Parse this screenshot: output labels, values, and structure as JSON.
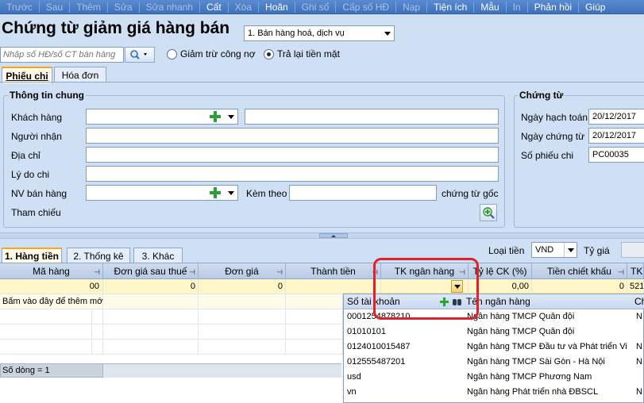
{
  "toolbar": {
    "items": [
      {
        "label": "Trước",
        "enabled": false
      },
      {
        "label": "Sau",
        "enabled": false
      },
      {
        "label": "Thêm",
        "enabled": false
      },
      {
        "label": "Sửa",
        "enabled": false
      },
      {
        "label": "Sửa nhanh",
        "enabled": false
      },
      {
        "label": "Cất",
        "enabled": true
      },
      {
        "label": "Xóa",
        "enabled": false
      },
      {
        "label": "Hoãn",
        "enabled": true
      },
      {
        "label": "Ghi sổ",
        "enabled": false
      },
      {
        "label": "Cấp số HĐ",
        "enabled": false
      },
      {
        "label": "Nạp",
        "enabled": false
      },
      {
        "label": "Tiện ích",
        "enabled": true
      },
      {
        "label": "Mẫu",
        "enabled": true
      },
      {
        "label": "In",
        "enabled": false
      },
      {
        "label": "Phản hồi",
        "enabled": true
      },
      {
        "label": "Giúp",
        "enabled": true
      }
    ]
  },
  "header": {
    "title": "Chứng từ giảm giá hàng bán",
    "type_selected": "1. Bán hàng hoá, dịch vụ",
    "search_placeholder": "Nhập số HĐ/số CT bán hàng",
    "radio_reduce": "Giảm trừ công nợ",
    "radio_cash": "Trả lại tiền mặt"
  },
  "doc_tabs": [
    "Phiếu chi",
    "Hóa đơn"
  ],
  "general": {
    "title": "Thông tin chung",
    "customer_label": "Khách hàng",
    "recipient_label": "Người nhận",
    "address_label": "Địa chỉ",
    "reason_label": "Lý do chi",
    "salesperson_label": "NV bán hàng",
    "attach_label": "Kèm theo",
    "attach_suffix": "chứng từ gốc",
    "reference_label": "Tham chiếu"
  },
  "voucher": {
    "title": "Chứng từ",
    "posting_date_label": "Ngày hạch toán",
    "posting_date": "20/12/2017",
    "voucher_date_label": "Ngày chứng từ",
    "voucher_date": "20/12/2017",
    "voucher_no_label": "Số phiếu chi",
    "voucher_no": "PC00035"
  },
  "detail_tabs": [
    "1. Hàng tiền",
    "2. Thống kê",
    "3. Khác"
  ],
  "currency": {
    "label": "Loại tiền",
    "value": "VND",
    "rate_label": "Tỷ giá"
  },
  "grid": {
    "columns": [
      "Mã hàng",
      "Đơn giá sau thuế",
      "Đơn giá",
      "Thành tiền",
      "TK ngân hàng",
      "Tỷ lệ CK (%)",
      "Tiền chiết khấu",
      "TK"
    ],
    "row1": {
      "qty_tail": "00",
      "unit_price_after_tax": "0",
      "unit_price": "0",
      "discount_rate": "0,00",
      "discount_amount": "0",
      "tk_tail": "521"
    },
    "add_row_text": "Bấm vào đây để thêm mới",
    "row_count": "Số dòng = 1"
  },
  "bank_popup": {
    "col_account": "Số tài khoản",
    "col_bank": "Tên ngân hàng",
    "col_extra": "Ch",
    "rows": [
      {
        "account": "0001254878210",
        "bank": "Ngân hàng TMCP Quân đội",
        "extra": "N"
      },
      {
        "account": "01010101",
        "bank": "Ngân hàng TMCP Quân đội",
        "extra": ""
      },
      {
        "account": "0124010015487",
        "bank": "Ngân hàng TMCP Đầu tư và Phát triển Vi",
        "extra": "N"
      },
      {
        "account": "012555487201",
        "bank": "Ngân hàng TMCP  Sài Gòn - Hà Nội",
        "extra": "N"
      },
      {
        "account": "usd",
        "bank": "Ngân hàng TMCP Phương Nam",
        "extra": ""
      },
      {
        "account": "vn",
        "bank": "Ngân hàng Phát triển nhà ĐBSCL",
        "extra": "N"
      }
    ]
  },
  "colors": {
    "highlight": "#e0202a",
    "toolbar": "#3f72bd",
    "tab_accent": "#f5a623"
  }
}
